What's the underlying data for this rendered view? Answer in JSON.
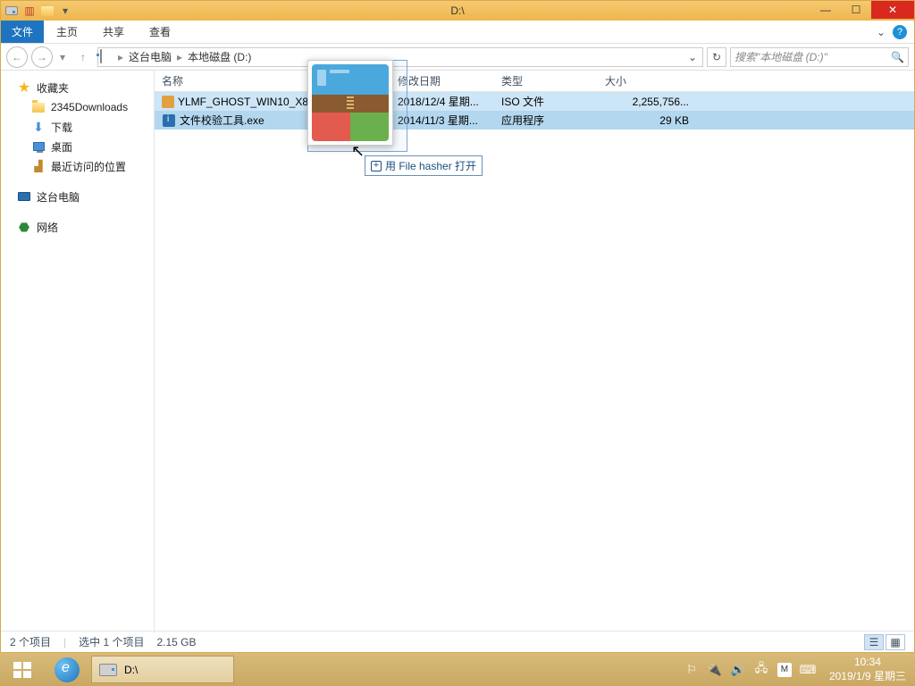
{
  "window": {
    "title": "D:\\"
  },
  "ribbon": {
    "file": "文件",
    "tabs": [
      "主页",
      "共享",
      "查看"
    ]
  },
  "address": {
    "segments": [
      "这台电脑",
      "本地磁盘 (D:)"
    ]
  },
  "search": {
    "placeholder": "搜索\"本地磁盘 (D:)\""
  },
  "sidebar": {
    "favorites": {
      "label": "收藏夹",
      "items": [
        "2345Downloads",
        "下载",
        "桌面",
        "最近访问的位置"
      ]
    },
    "computer": {
      "label": "这台电脑"
    },
    "network": {
      "label": "网络"
    }
  },
  "columns": {
    "name": "名称",
    "date": "修改日期",
    "type": "类型",
    "size": "大小"
  },
  "files": [
    {
      "name": "YLMF_GHOST_WIN10_X86_V2018_12.iso",
      "date": "2018/12/4 星期...",
      "type": "ISO 文件",
      "size": "2,255,756..."
    },
    {
      "name": "文件校验工具.exe",
      "date": "2014/11/3 星期...",
      "type": "应用程序",
      "size": "29 KB"
    }
  ],
  "status": {
    "items": "2 个项目",
    "selected": "选中 1 个项目",
    "size": "2.15 GB"
  },
  "tooltip": {
    "text": "用 File hasher 打开"
  },
  "taskbar": {
    "app": {
      "label": "D:\\"
    },
    "clock": {
      "time": "10:34",
      "date": "2019/1/9 星期三"
    }
  }
}
